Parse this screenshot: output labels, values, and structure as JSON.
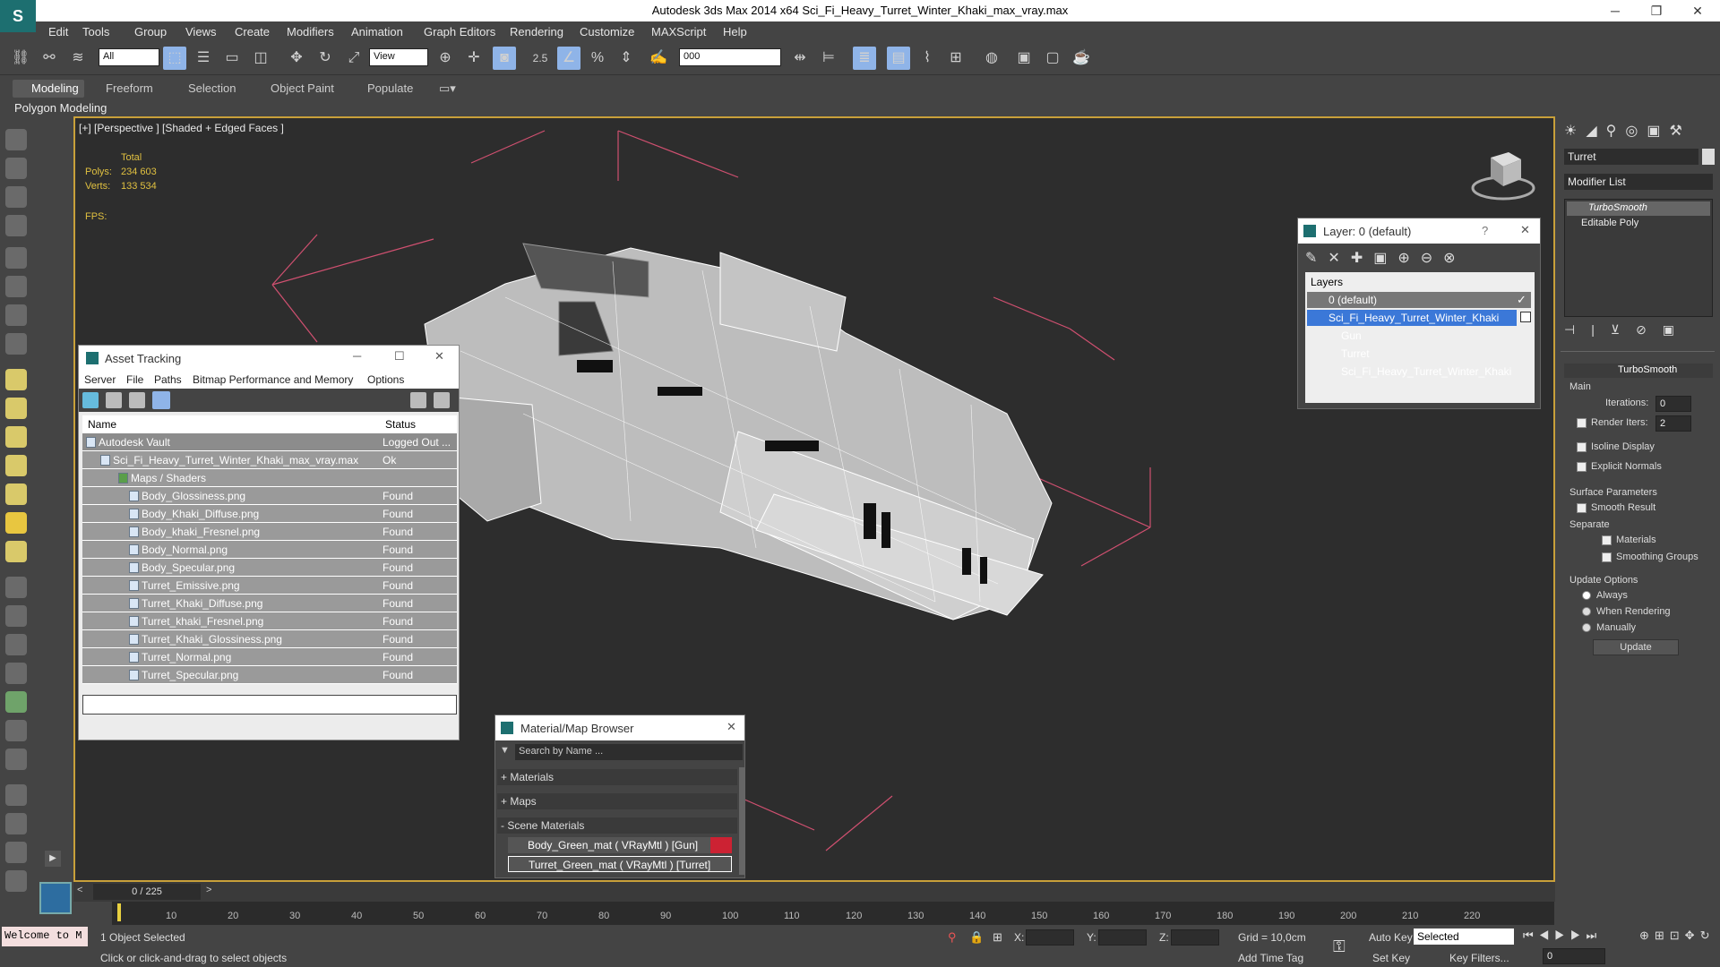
{
  "app": {
    "title": "Autodesk 3ds Max  2014 x64    Sci_Fi_Heavy_Turret_Winter_Khaki_max_vray.max"
  },
  "menu": [
    "Edit",
    "Tools",
    "Group",
    "Views",
    "Create",
    "Modifiers",
    "Animation",
    "Graph Editors",
    "Rendering",
    "Customize",
    "MAXScript",
    "Help"
  ],
  "toolbar": {
    "filter": "All",
    "ref_coord": "View",
    "named_sel": "000",
    "snap_label": "2.5"
  },
  "ribbon": {
    "tabs": [
      "Modeling",
      "Freeform",
      "Selection",
      "Object Paint",
      "Populate"
    ],
    "sub": "Polygon Modeling"
  },
  "viewport": {
    "label": "[+] [Perspective ] [Shaded + Edged Faces ]",
    "stats": {
      "total": "Total",
      "polys_label": "Polys:",
      "polys": "234 603",
      "verts_label": "Verts:",
      "verts": "133 534",
      "fps": "FPS:"
    }
  },
  "asset_tracking": {
    "title": "Asset Tracking",
    "menu": [
      "Server",
      "File",
      "Paths",
      "Bitmap Performance and Memory",
      "Options"
    ],
    "cols": [
      "Name",
      "Status"
    ],
    "rows": [
      {
        "name": "Autodesk Vault",
        "status": "Logged Out ..."
      },
      {
        "name": "Sci_Fi_Heavy_Turret_Winter_Khaki_max_vray.max",
        "status": "Ok"
      },
      {
        "name": "Maps / Shaders",
        "status": ""
      },
      {
        "name": "Body_Glossiness.png",
        "status": "Found"
      },
      {
        "name": "Body_Khaki_Diffuse.png",
        "status": "Found"
      },
      {
        "name": "Body_khaki_Fresnel.png",
        "status": "Found"
      },
      {
        "name": "Body_Normal.png",
        "status": "Found"
      },
      {
        "name": "Body_Specular.png",
        "status": "Found"
      },
      {
        "name": "Turret_Emissive.png",
        "status": "Found"
      },
      {
        "name": "Turret_Khaki_Diffuse.png",
        "status": "Found"
      },
      {
        "name": "Turret_khaki_Fresnel.png",
        "status": "Found"
      },
      {
        "name": "Turret_Khaki_Glossiness.png",
        "status": "Found"
      },
      {
        "name": "Turret_Normal.png",
        "status": "Found"
      },
      {
        "name": "Turret_Specular.png",
        "status": "Found"
      }
    ]
  },
  "layer_dialog": {
    "title": "Layer: 0 (default)",
    "help": "?",
    "header": "Layers",
    "items": [
      "0 (default)",
      "Sci_Fi_Heavy_Turret_Winter_Khaki",
      "Gun",
      "Turret",
      "Sci_Fi_Heavy_Turret_Winter_Khaki"
    ]
  },
  "material_browser": {
    "title": "Material/Map Browser",
    "search_placeholder": "Search by Name ...",
    "groups": [
      "+ Materials",
      "+ Maps",
      "- Scene Materials"
    ],
    "materials": [
      "Body_Green_mat ( VRayMtl ) [Gun]",
      "Turret_Green_mat ( VRayMtl ) [Turret]"
    ]
  },
  "command_panel": {
    "object_name": "Turret",
    "modifier_list": "Modifier List",
    "stack": [
      "TurboSmooth",
      "Editable Poly"
    ],
    "rollout": "TurboSmooth",
    "main": "Main",
    "iterations_label": "Iterations:",
    "iterations": "0",
    "render_iters_label": "Render Iters:",
    "render_iters": "2",
    "isoline": "Isoline Display",
    "explicit": "Explicit Normals",
    "surface": "Surface Parameters",
    "smooth_result": "Smooth Result",
    "separate": "Separate",
    "materials": "Materials",
    "smoothing_groups": "Smoothing Groups",
    "update_options": "Update Options",
    "always": "Always",
    "when_rendering": "When Rendering",
    "manually": "Manually",
    "update_btn": "Update"
  },
  "timeline": {
    "frame": "0 / 225",
    "ticks": [
      "10",
      "20",
      "30",
      "40",
      "50",
      "60",
      "70",
      "80",
      "90",
      "100",
      "110",
      "120",
      "130",
      "140",
      "150",
      "160",
      "170",
      "180",
      "190",
      "200",
      "210",
      "220"
    ]
  },
  "status": {
    "welcome": "Welcome to M",
    "selected": "1 Object Selected",
    "hint": "Click or click-and-drag to select objects",
    "x": "X:",
    "y": "Y:",
    "z": "Z:",
    "grid": "Grid = 10,0cm",
    "add_time_tag": "Add Time Tag",
    "auto_key": "Auto Key",
    "set_key": "Set Key",
    "selected_dd": "Selected",
    "key_filters": "Key Filters...",
    "frame_field": "0"
  }
}
